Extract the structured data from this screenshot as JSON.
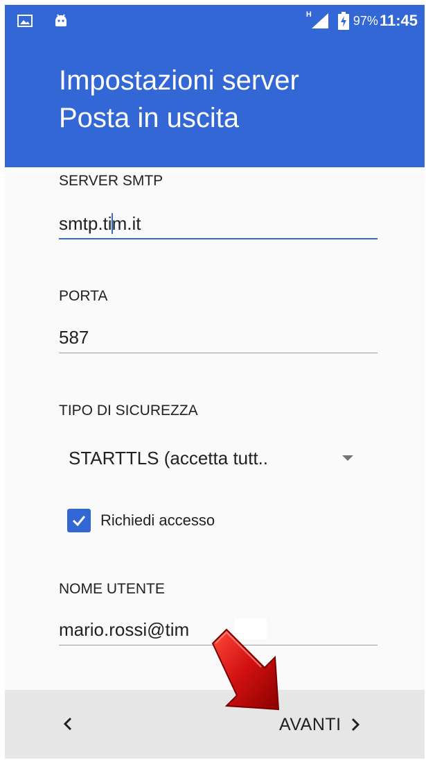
{
  "status_bar": {
    "icons": [
      "image-icon",
      "android-icon",
      "signal-icon",
      "battery-charging-icon"
    ],
    "network_badge": "H",
    "battery_percent": "97%",
    "time": "11:45"
  },
  "header": {
    "title_line1": "Impostazioni server",
    "title_line2": "Posta in uscita",
    "color": "#3367d6"
  },
  "form": {
    "smtp_server": {
      "label": "SERVER SMTP",
      "value": "smtp.tim.it"
    },
    "port": {
      "label": "PORTA",
      "value": "587"
    },
    "security": {
      "label": "TIPO DI SICUREZZA",
      "selected": "STARTTLS (accetta tutt.."
    },
    "require_login": {
      "label": "Richiedi accesso",
      "checked": true
    },
    "username": {
      "label": "NOME UTENTE",
      "value": "mario.rossi@tim"
    }
  },
  "footer": {
    "back_icon": "chevron-left-icon",
    "next_label": "AVANTI",
    "next_icon": "chevron-right-icon"
  },
  "annotation": {
    "icon": "red-arrow-icon",
    "color": "#d01010"
  }
}
